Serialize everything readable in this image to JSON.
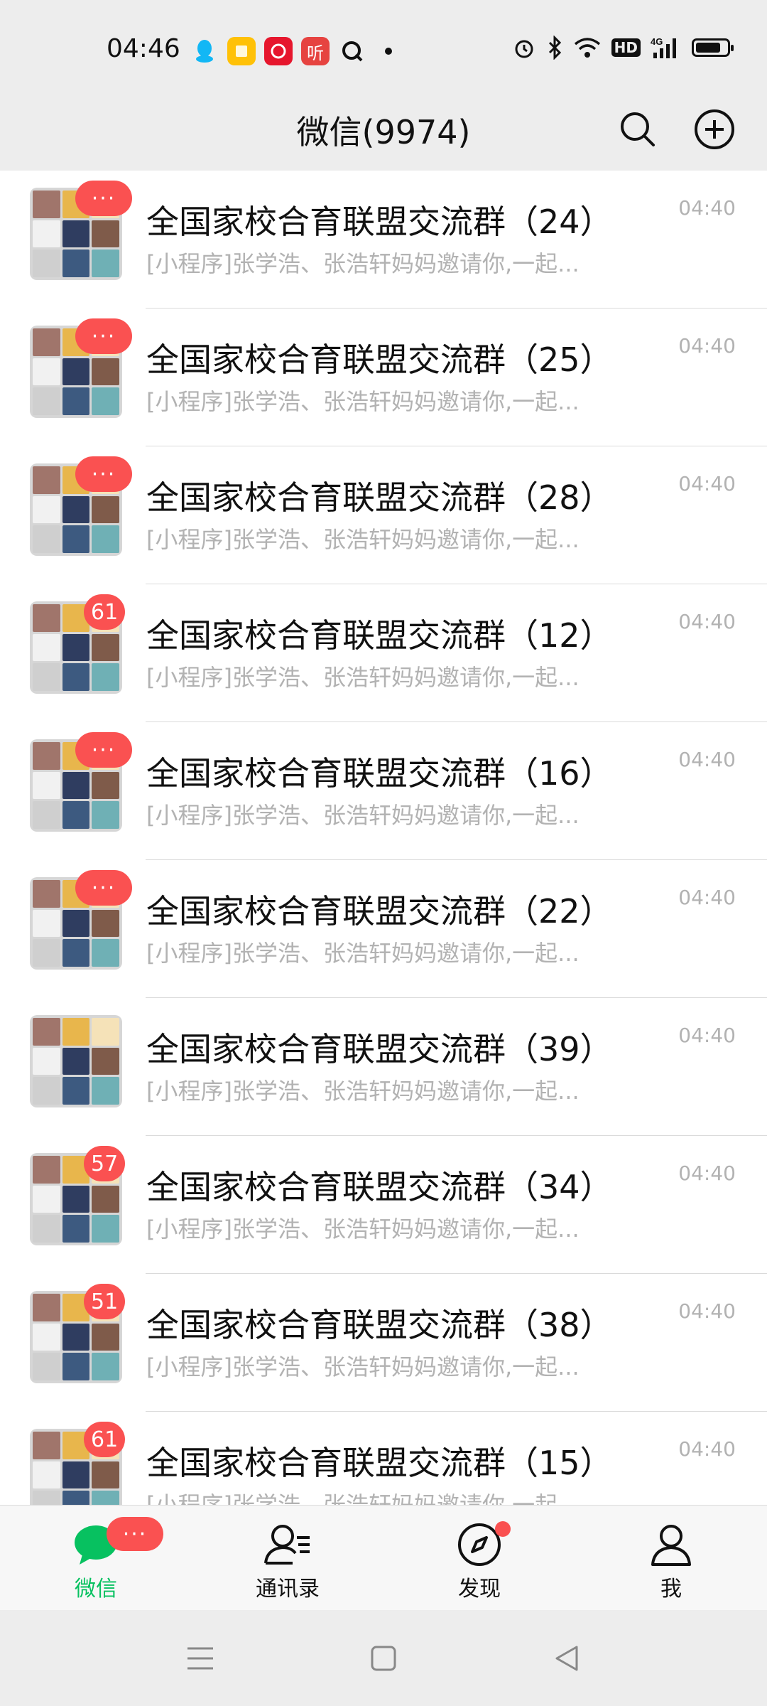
{
  "status_bar": {
    "time": "04:46",
    "app_icons": [
      "qq-icon",
      "notes-icon",
      "weibo-icon",
      "ting-icon",
      "qq-browser-icon"
    ],
    "app_glyphs": [
      "",
      "",
      "",
      "听",
      ""
    ],
    "app_colors": [
      "#12b7f5",
      "#ffc107",
      "#e6162d",
      "#e64340",
      "#111111"
    ],
    "battery_level": 0.8
  },
  "header": {
    "title": "微信(9974)"
  },
  "chats": [
    {
      "title": "全国家校合育联盟交流群（24）",
      "preview": "[小程序]张学浩、张浩轩妈妈邀请你,一起...",
      "time": "04:40",
      "badge": "···"
    },
    {
      "title": "全国家校合育联盟交流群（25）",
      "preview": "[小程序]张学浩、张浩轩妈妈邀请你,一起...",
      "time": "04:40",
      "badge": "···"
    },
    {
      "title": "全国家校合育联盟交流群（28）",
      "preview": "[小程序]张学浩、张浩轩妈妈邀请你,一起...",
      "time": "04:40",
      "badge": "···"
    },
    {
      "title": "全国家校合育联盟交流群（12）",
      "preview": "[小程序]张学浩、张浩轩妈妈邀请你,一起...",
      "time": "04:40",
      "badge": "61"
    },
    {
      "title": "全国家校合育联盟交流群（16）",
      "preview": "[小程序]张学浩、张浩轩妈妈邀请你,一起...",
      "time": "04:40",
      "badge": "···"
    },
    {
      "title": "全国家校合育联盟交流群（22）",
      "preview": "[小程序]张学浩、张浩轩妈妈邀请你,一起...",
      "time": "04:40",
      "badge": "···"
    },
    {
      "title": "全国家校合育联盟交流群（39）",
      "preview": "[小程序]张学浩、张浩轩妈妈邀请你,一起...",
      "time": "04:40",
      "badge": ""
    },
    {
      "title": "全国家校合育联盟交流群（34）",
      "preview": "[小程序]张学浩、张浩轩妈妈邀请你,一起...",
      "time": "04:40",
      "badge": "57"
    },
    {
      "title": "全国家校合育联盟交流群（38）",
      "preview": "[小程序]张学浩、张浩轩妈妈邀请你,一起...",
      "time": "04:40",
      "badge": "51"
    },
    {
      "title": "全国家校合育联盟交流群（15）",
      "preview": "[小程序]张学浩、张浩轩妈妈邀请你,一起...",
      "time": "04:40",
      "badge": "61"
    }
  ],
  "tabbar": {
    "tabs": [
      {
        "label": "微信",
        "icon": "chat-bubble-icon",
        "active": true,
        "badge": "···"
      },
      {
        "label": "通讯录",
        "icon": "contacts-icon",
        "active": false
      },
      {
        "label": "发现",
        "icon": "compass-icon",
        "active": false,
        "dot": true
      },
      {
        "label": "我",
        "icon": "person-icon",
        "active": false
      }
    ],
    "accent_color": "#07c160",
    "badge_color": "#fa5151"
  },
  "system_nav": {
    "buttons": [
      "menu-icon",
      "home-icon",
      "back-icon"
    ]
  }
}
